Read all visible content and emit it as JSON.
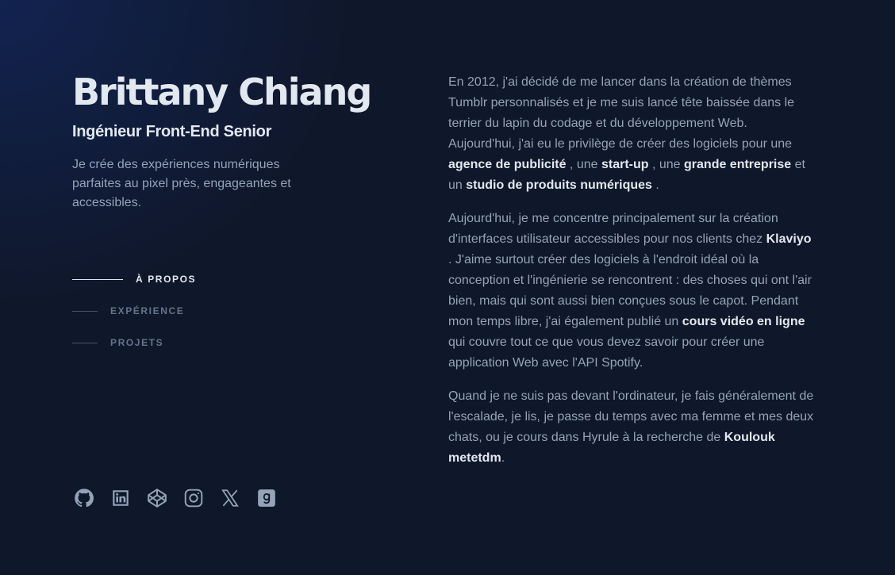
{
  "header": {
    "name": "Brittany Chiang",
    "role": "Ingénieur Front-End Senior",
    "tagline": "Je crée des expériences numériques parfaites au pixel près, engageantes et accessibles."
  },
  "nav": {
    "items": [
      {
        "label": "À PROPOS",
        "active": true
      },
      {
        "label": "EXPÉRIENCE",
        "active": false
      },
      {
        "label": "PROJETS",
        "active": false
      }
    ]
  },
  "socials": [
    {
      "icon": "github-icon"
    },
    {
      "icon": "linkedin-icon"
    },
    {
      "icon": "codepen-icon"
    },
    {
      "icon": "instagram-icon"
    },
    {
      "icon": "x-twitter-icon"
    },
    {
      "icon": "goodreads-icon"
    }
  ],
  "about": {
    "p1": {
      "t1": "En 2012, j'ai décidé de me lancer dans la création de thèmes Tumblr personnalisés et je me suis lancé tête baissée dans le terrier du lapin du codage et du développement Web. Aujourd'hui, j'ai eu le privilège de créer des logiciels pour une ",
      "l1": "agence de publicité",
      "t2": " , une ",
      "l2": "start-up",
      "t3": " , une ",
      "l3": "grande entreprise",
      "t4": " et un ",
      "l4": "studio de produits numériques",
      "t5": " ."
    },
    "p2": {
      "t1": "Aujourd'hui, je me concentre principalement sur la création d'interfaces utilisateur accessibles pour nos clients chez ",
      "l1": "Klaviyo",
      "t2": " . J'aime surtout créer des logiciels à l'endroit idéal où la conception et l'ingénierie se rencontrent : des choses qui ont l'air bien, mais qui sont aussi bien conçues sous le capot. Pendant mon temps libre, j'ai également publié un ",
      "l2": "cours vidéo en ligne",
      "t3": " qui couvre tout ce que vous devez savoir pour créer une application Web avec l'API Spotify."
    },
    "p3": {
      "t1": "Quand je ne suis pas devant l'ordinateur, je fais généralement de l'escalade, je lis, je passe du temps avec ma femme et mes deux chats, ou je cours dans Hyrule à la recherche de ",
      "l1": "Koulouk metetdm",
      "t2": "."
    }
  },
  "colors": {
    "background": "#0f172a",
    "heading": "#e2e8f0",
    "text": "#94a3b8",
    "muted": "#64748b"
  }
}
